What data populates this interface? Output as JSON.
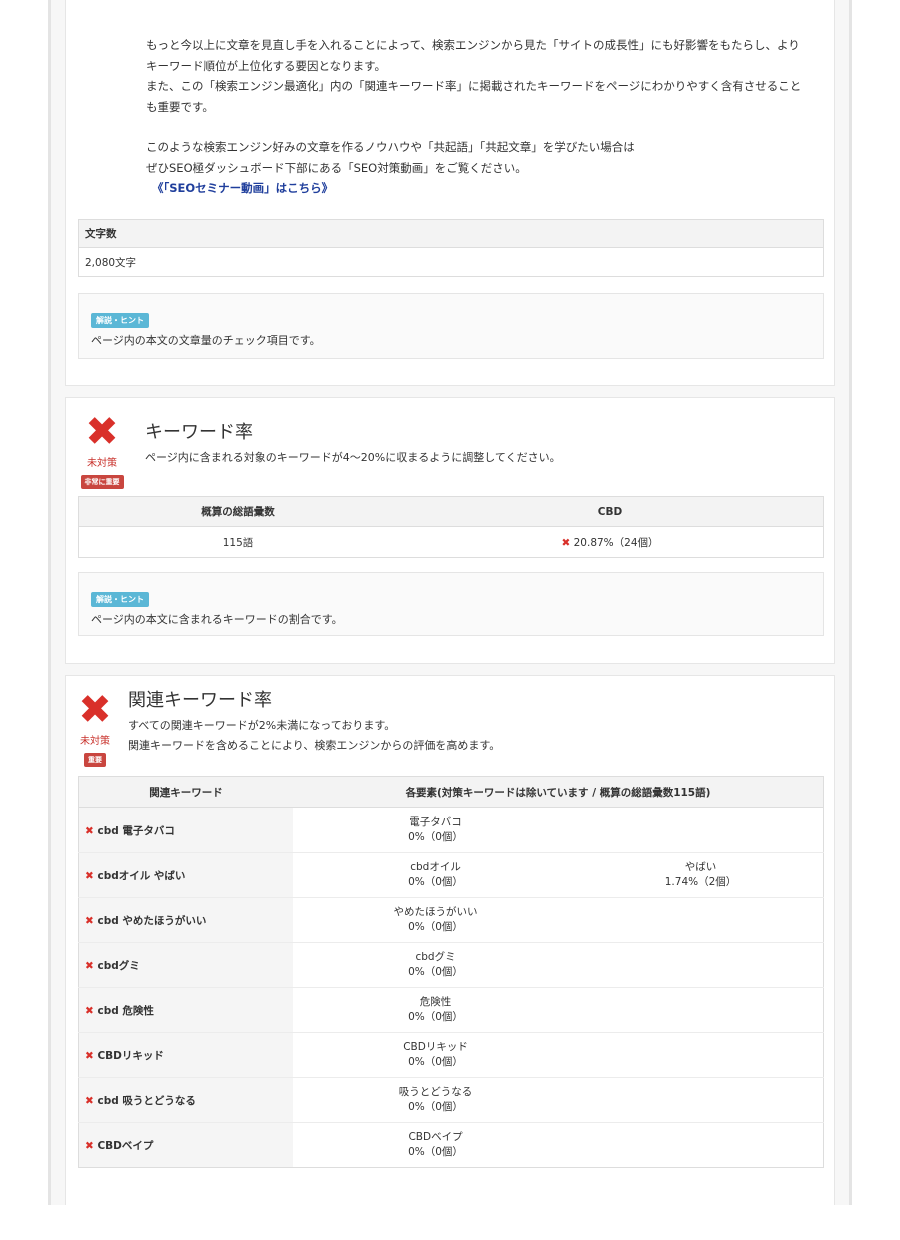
{
  "intro": {
    "lines": [
      "もっと今以上に文章を見直し手を入れることによって、検索エンジンから見た「サイトの成長性」にも好影響をもたらし、より",
      "キーワード順位が上位化する要因となります。",
      "また、この「検索エンジン最適化」内の「関連キーワード率」に掲載されたキーワードをページにわかりやすく含有させること",
      "も重要です。"
    ],
    "lines2": [
      "このような検索エンジン好みの文章を作るノウハウや「共起語」「共起文章」を学びたい場合は",
      "ぜひSEO極ダッシュボード下部にある「SEO対策動画」をご覧ください。"
    ],
    "link": "《「SEOセミナー動画」はこちら》"
  },
  "word_count": {
    "header": "文字数",
    "value": "2,080文字",
    "hint_badge": "解説・ヒント",
    "hint_text": "ページ内の本文の文章量のチェック項目です。"
  },
  "keyword_rate": {
    "status_icon": "✖",
    "status_label": "未対策",
    "status_badge": "非常に重要",
    "title": "キーワード率",
    "description": "ページ内に含まれる対象のキーワードが4～20%に収まるように調整してください。",
    "col_total": "概算の総語彙数",
    "col_keyword": "CBD",
    "total_value": "115語",
    "keyword_value": "20.87%（24個）",
    "hint_badge": "解説・ヒント",
    "hint_text": "ページ内の本文に含まれるキーワードの割合です。"
  },
  "related_keyword_rate": {
    "status_icon": "✖",
    "status_label": "未対策",
    "status_badge": "重要",
    "title": "関連キーワード率",
    "description1": "すべての関連キーワードが2%未満になっております。",
    "description2": "関連キーワードを含めることにより、検索エンジンからの評価を高めます。",
    "col_keyword": "関連キーワード",
    "col_elements": "各要素(対策キーワードは除いています / 概算の総語彙数115語)",
    "rows": [
      {
        "keyword": "cbd 電子タバコ",
        "el1_name": "電子タバコ",
        "el1_value": "0%（0個）",
        "el2_name": "",
        "el2_value": ""
      },
      {
        "keyword": "cbdオイル やばい",
        "el1_name": "cbdオイル",
        "el1_value": "0%（0個）",
        "el2_name": "やばい",
        "el2_value": "1.74%（2個）"
      },
      {
        "keyword": "cbd やめたほうがいい",
        "el1_name": "やめたほうがいい",
        "el1_value": "0%（0個）",
        "el2_name": "",
        "el2_value": ""
      },
      {
        "keyword": "cbdグミ",
        "el1_name": "cbdグミ",
        "el1_value": "0%（0個）",
        "el2_name": "",
        "el2_value": ""
      },
      {
        "keyword": "cbd 危険性",
        "el1_name": "危険性",
        "el1_value": "0%（0個）",
        "el2_name": "",
        "el2_value": ""
      },
      {
        "keyword": "CBDリキッド",
        "el1_name": "CBDリキッド",
        "el1_value": "0%（0個）",
        "el2_name": "",
        "el2_value": ""
      },
      {
        "keyword": "cbd 吸うとどうなる",
        "el1_name": "吸うとどうなる",
        "el1_value": "0%（0個）",
        "el2_name": "",
        "el2_value": ""
      },
      {
        "keyword": "CBDベイプ",
        "el1_name": "CBDベイプ",
        "el1_value": "0%（0個）",
        "el2_name": "",
        "el2_value": ""
      }
    ]
  }
}
